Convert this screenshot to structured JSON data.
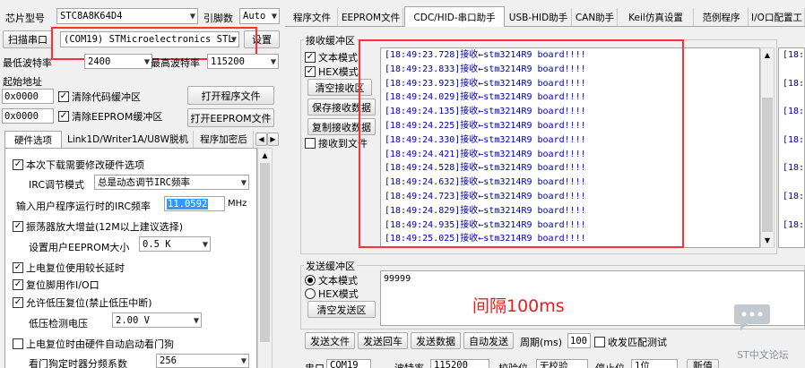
{
  "left": {
    "chip_label": "芯片型号",
    "chip_value": "STC8A8K64D4",
    "pins_label": "引脚数",
    "pins_value": "Auto",
    "scan_button": "扫描串口",
    "port_value": "(COM19) STMicroelectronics STL",
    "settings_button": "设置",
    "min_baud_label": "最低波特率",
    "min_baud_value": "2400",
    "max_baud_label": "最高波特率",
    "max_baud_value": "115200",
    "start_addr_label": "起始地址",
    "addr1_value": "0x0000",
    "clear_code_label": "清除代码缓冲区",
    "open_program_button": "打开程序文件",
    "addr2_value": "0x0000",
    "clear_eeprom_label": "清除EEPROM缓冲区",
    "open_eeprom_button": "打开EEPROM文件",
    "tabs": [
      "硬件选项",
      "Link1D/Writer1A/U8W脱机",
      "程序加密后"
    ],
    "options": {
      "opt1": "本次下载需要修改硬件选项",
      "irc_mode_label": "IRC调节模式",
      "irc_mode_value": "总是动态调节IRC频率",
      "irc_freq_label": "输入用户程序运行时的IRC频率",
      "irc_freq_value": "11.0592",
      "irc_freq_unit": "MHz",
      "opt2": "振荡器放大增益(12M以上建议选择)",
      "eeprom_size_label": "设置用户EEPROM大小",
      "eeprom_size_value": "0.5 K",
      "opt3": "上电复位使用较长延时",
      "opt4": "复位脚用作I/O口",
      "opt5": "允许低压复位(禁止低压中断)",
      "lvd_label": "低压检测电压",
      "lvd_value": "2.00 V",
      "opt6": "上电复位时由硬件自动启动看门狗",
      "wdt_label": "看门狗定时器分频系数",
      "wdt_value": "256"
    }
  },
  "right": {
    "tabs": [
      "程序文件",
      "EEPROM文件",
      "CDC/HID-串口助手",
      "USB-HID助手",
      "CAN助手",
      "Keil仿真设置",
      "范例程序",
      "I/O口配置工"
    ],
    "recv_title": "接收缓冲区",
    "recv_text_mode": "文本模式",
    "recv_hex_mode": "HEX模式",
    "clear_recv_button": "清空接收区",
    "save_recv_button": "保存接收数据",
    "copy_recv_button": "复制接收数据",
    "recv_to_file": "接收到文件",
    "log_lines": [
      "[18:49:23.728]接收←stm3214R9 board!!!!",
      "[18:49:23.833]接收←stm3214R9 board!!!!",
      "[18:49:23.923]接收←stm3214R9 board!!!!",
      "[18:49:24.029]接收←stm3214R9 board!!!!",
      "[18:49:24.135]接收←stm3214R9 board!!!!",
      "[18:49:24.225]接收←stm3214R9 board!!!!",
      "[18:49:24.330]接收←stm3214R9 board!!!!",
      "[18:49:24.421]接收←stm3214R9 board!!!!",
      "[18:49:24.528]接收←stm3214R9 board!!!!",
      "[18:49:24.632]接收←stm3214R9 board!!!!",
      "[18:49:24.723]接收←stm3214R9 board!!!!",
      "[18:49:24.829]接收←stm3214R9 board!!!!",
      "[18:49:24.935]接收←stm3214R9 board!!!!",
      "[18:49:25.025]接收←stm3214R9 board!!!!"
    ],
    "right_pane_prefix": "[18:",
    "send_title": "发送缓冲区",
    "send_text_mode": "文本模式",
    "send_hex_mode": "HEX模式",
    "clear_send_button": "清空发送区",
    "send_value": "99999",
    "annotation": "间隔100ms",
    "send_file_button": "发送文件",
    "send_enter_button": "发送回车",
    "send_data_button": "发送数据",
    "auto_send_button": "自动发送",
    "period_label": "周期(ms)",
    "period_value": "100",
    "recv_match_label": "收发匹配测试",
    "bottom_port_label": "串口",
    "bottom_port_value": "COM19",
    "bottom_baud_label": "波特率",
    "bottom_baud_value": "115200",
    "bottom_parity_label": "校验位",
    "bottom_parity_value": "无校验",
    "bottom_stop_label": "停止位",
    "bottom_stop_value": "1位",
    "bottom_new_button": "新值"
  },
  "watermark": "ST中文论坛",
  "colors": {
    "highlight": "#ff3030",
    "log_text": "#0000b0",
    "annotation": "#e02020",
    "selected": "#3399ff"
  }
}
